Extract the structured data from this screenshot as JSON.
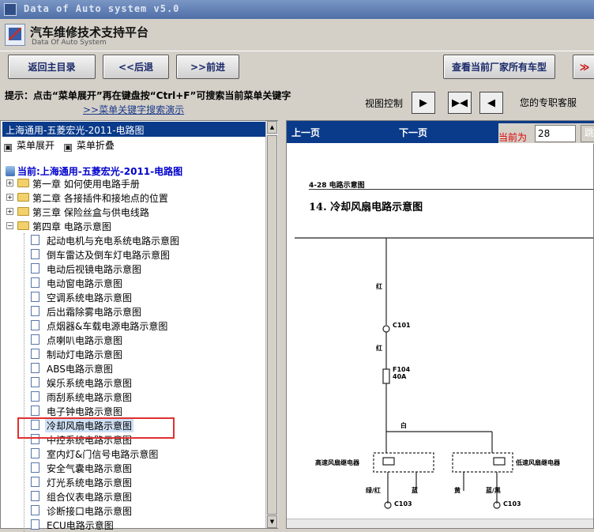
{
  "window": {
    "title": "Data of Auto system v5.0"
  },
  "header": {
    "title_cn": "汽车维修技术支持平台",
    "title_en": "Data Of Auto System"
  },
  "toolbar": {
    "home": "返回主目录",
    "back": "<<后退",
    "forward": ">>前进",
    "all_models": "查看当前厂家所有车型",
    "more": "≫"
  },
  "hint": {
    "tip": "提示：点击“菜单展开”再在键盘按“Ctrl+F”可搜索当前菜单关键字",
    "link": ">>菜单关键字搜索演示",
    "view_control": "视图控制",
    "service": "您的专职客服"
  },
  "left": {
    "header": "上海通用-五菱宏光-2011-电路图",
    "expand": "菜单展开",
    "collapse": "菜单折叠",
    "current": "当前:上海通用-五菱宏光-2011-电路图",
    "chapters": [
      "第一章 如何使用电路手册",
      "第二章 各接插件和接地点的位置",
      "第三章 保险丝盒与供电线路",
      "第四章 电路示意图"
    ],
    "items": [
      "起动电机与充电系统电路示意图",
      "倒车雷达及倒车灯电路示意图",
      "电动后视镜电路示意图",
      "电动窗电路示意图",
      "空调系统电路示意图",
      "后出霜除雾电路示意图",
      "点烟器&车载电源电路示意图",
      "点喇叭电路示意图",
      "制动灯电路示意图",
      "ABS电路示意图",
      "娱乐系统电路示意图",
      "雨刮系统电路示意图",
      "电子钟电路示意图",
      "冷却风扇电路示意图",
      "中控系统电路示意图",
      "室内灯&门信号电路示意图",
      "安全气囊电路示意图",
      "灯光系统电路示意图",
      "组合仪表电路示意图",
      "诊断接口电路示意图",
      "ECU电路示意图"
    ]
  },
  "right": {
    "prev": "上一页",
    "next": "下一页",
    "current_label": "当前为",
    "page": "28",
    "go": "跳",
    "diagram": {
      "section": "4-28 电路示意图",
      "title": "14. 冷却风扇电路示意图",
      "labels": [
        "红",
        "C101",
        "红",
        "F104 40A",
        "白",
        "高速风扇继电器",
        "低速风扇继电器",
        "绿/红",
        "蓝",
        "黄",
        "蓝/黑",
        "C103",
        "C103"
      ]
    }
  }
}
